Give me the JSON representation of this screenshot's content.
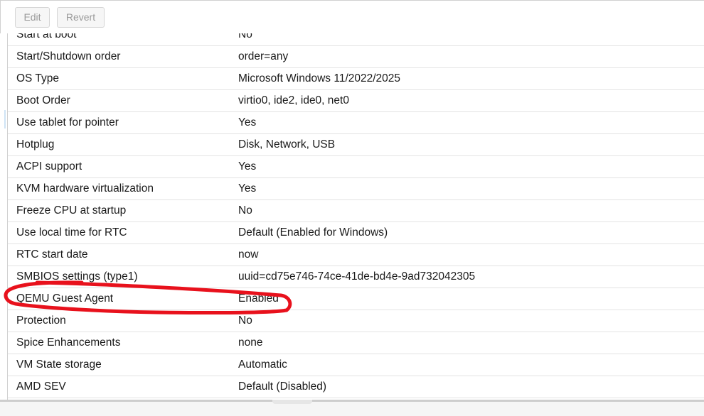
{
  "toolbar": {
    "edit_label": "Edit",
    "revert_label": "Revert"
  },
  "options": [
    {
      "name": "Start at boot",
      "value": "No"
    },
    {
      "name": "Start/Shutdown order",
      "value": "order=any"
    },
    {
      "name": "OS Type",
      "value": "Microsoft Windows 11/2022/2025"
    },
    {
      "name": "Boot Order",
      "value": "virtio0, ide2, ide0, net0"
    },
    {
      "name": "Use tablet for pointer",
      "value": "Yes"
    },
    {
      "name": "Hotplug",
      "value": "Disk, Network, USB"
    },
    {
      "name": "ACPI support",
      "value": "Yes"
    },
    {
      "name": "KVM hardware virtualization",
      "value": "Yes"
    },
    {
      "name": "Freeze CPU at startup",
      "value": "No"
    },
    {
      "name": "Use local time for RTC",
      "value": "Default (Enabled for Windows)"
    },
    {
      "name": "RTC start date",
      "value": "now"
    },
    {
      "name": "SMBIOS settings (type1)",
      "value": "uuid=cd75e746-74ce-41de-bd4e-9ad732042305"
    },
    {
      "name": "QEMU Guest Agent",
      "value": "Enabled"
    },
    {
      "name": "Protection",
      "value": "No"
    },
    {
      "name": "Spice Enhancements",
      "value": "none"
    },
    {
      "name": "VM State storage",
      "value": "Automatic"
    },
    {
      "name": "AMD SEV",
      "value": "Default (Disabled)"
    }
  ],
  "annotation_color": "#e8111c"
}
